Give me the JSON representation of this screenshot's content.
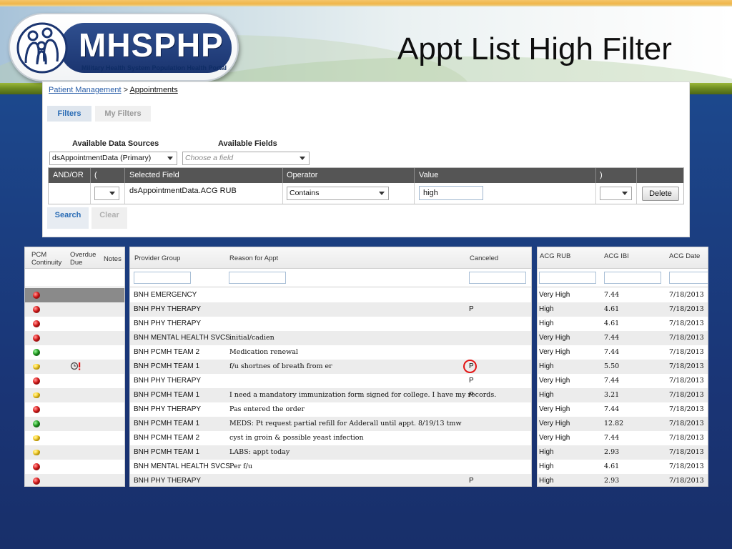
{
  "slide": {
    "title": "Appt List High Filter",
    "logo_text": "MHSPHP",
    "logo_tagline": "Military Health System Population Health Portal"
  },
  "breadcrumb": {
    "root": "Patient Management",
    "separator": ">",
    "current": "Appointments"
  },
  "filter_tabs": [
    "Filters",
    "My Filters"
  ],
  "filter_builder": {
    "available_data_sources_label": "Available Data Sources",
    "available_fields_label": "Available Fields",
    "data_source_value": "dsAppointmentData (Primary)",
    "field_placeholder": "Choose a field",
    "columns": [
      "AND/OR",
      "(",
      "Selected Field",
      "Operator",
      "Value",
      ")"
    ],
    "row": {
      "selected_field": "dsAppointmentData.ACG RUB",
      "operator": "Contains",
      "value": "high",
      "delete_label": "Delete"
    },
    "search_label": "Search",
    "clear_label": "Clear"
  },
  "left_grid": {
    "headers": {
      "pcm_line1": "PCM",
      "pcm_line2": "Continuity",
      "overdue_line1": "Overdue",
      "overdue_line2": "Due",
      "notes": "Notes"
    },
    "rows": [
      {
        "status": "red",
        "overdue": false
      },
      {
        "status": "red",
        "overdue": false
      },
      {
        "status": "red",
        "overdue": false
      },
      {
        "status": "red",
        "overdue": false
      },
      {
        "status": "green",
        "overdue": false
      },
      {
        "status": "yellow",
        "overdue": true
      },
      {
        "status": "red",
        "overdue": false
      },
      {
        "status": "yellow",
        "overdue": false
      },
      {
        "status": "red",
        "overdue": false
      },
      {
        "status": "green",
        "overdue": false
      },
      {
        "status": "yellow",
        "overdue": false
      },
      {
        "status": "yellow",
        "overdue": false
      },
      {
        "status": "red",
        "overdue": false
      },
      {
        "status": "red",
        "overdue": false
      }
    ]
  },
  "middle_grid": {
    "headers": {
      "provider_group": "Provider Group",
      "reason": "Reason for Appt",
      "canceled": "Canceled"
    },
    "rows": [
      {
        "provider_group": "BNH EMERGENCY",
        "reason": "",
        "canceled": ""
      },
      {
        "provider_group": "BNH PHY THERAPY",
        "reason": "",
        "canceled": "P"
      },
      {
        "provider_group": "BNH PHY THERAPY",
        "reason": "",
        "canceled": ""
      },
      {
        "provider_group": "BNH MENTAL HEALTH SVCS",
        "reason": "initial/cadien",
        "canceled": ""
      },
      {
        "provider_group": "BNH PCMH TEAM 2",
        "reason": "Medication renewal",
        "canceled": ""
      },
      {
        "provider_group": "BNH PCMH TEAM 1",
        "reason": "f/u shortnes of breath from er",
        "canceled": "P"
      },
      {
        "provider_group": "BNH PHY THERAPY",
        "reason": "",
        "canceled": "P"
      },
      {
        "provider_group": "BNH PCMH TEAM 1",
        "reason": "I need a mandatory immunization form signed for college. I have my records.",
        "canceled": "P"
      },
      {
        "provider_group": "BNH PHY THERAPY",
        "reason": "Pas entered the order",
        "canceled": ""
      },
      {
        "provider_group": "BNH PCMH TEAM 1",
        "reason": "MEDS: Pt request partial refill for Adderall until appt. 8/19/13 tmw",
        "canceled": ""
      },
      {
        "provider_group": "BNH PCMH TEAM 2",
        "reason": "cyst in groin & possible yeast infection",
        "canceled": ""
      },
      {
        "provider_group": "BNH PCMH TEAM 1",
        "reason": "LABS: appt today",
        "canceled": ""
      },
      {
        "provider_group": "BNH MENTAL HEALTH SVCS",
        "reason": "Per f/u",
        "canceled": ""
      },
      {
        "provider_group": "BNH PHY THERAPY",
        "reason": "",
        "canceled": "P"
      }
    ]
  },
  "right_grid": {
    "headers": {
      "acg_rub": "ACG RUB",
      "acg_ibi": "ACG IBI",
      "acg_date": "ACG Date"
    },
    "rows": [
      {
        "acg_rub": "Very High",
        "acg_ibi": "7.44",
        "acg_date": "7/18/2013"
      },
      {
        "acg_rub": "High",
        "acg_ibi": "4.61",
        "acg_date": "7/18/2013"
      },
      {
        "acg_rub": "High",
        "acg_ibi": "4.61",
        "acg_date": "7/18/2013"
      },
      {
        "acg_rub": "Very High",
        "acg_ibi": "7.44",
        "acg_date": "7/18/2013"
      },
      {
        "acg_rub": "Very High",
        "acg_ibi": "7.44",
        "acg_date": "7/18/2013"
      },
      {
        "acg_rub": "High",
        "acg_ibi": "5.50",
        "acg_date": "7/18/2013"
      },
      {
        "acg_rub": "Very High",
        "acg_ibi": "7.44",
        "acg_date": "7/18/2013"
      },
      {
        "acg_rub": "High",
        "acg_ibi": "3.21",
        "acg_date": "7/18/2013"
      },
      {
        "acg_rub": "Very High",
        "acg_ibi": "7.44",
        "acg_date": "7/18/2013"
      },
      {
        "acg_rub": "Very High",
        "acg_ibi": "12.82",
        "acg_date": "7/18/2013"
      },
      {
        "acg_rub": "Very High",
        "acg_ibi": "7.44",
        "acg_date": "7/18/2013"
      },
      {
        "acg_rub": "High",
        "acg_ibi": "2.93",
        "acg_date": "7/18/2013"
      },
      {
        "acg_rub": "High",
        "acg_ibi": "4.61",
        "acg_date": "7/18/2013"
      },
      {
        "acg_rub": "High",
        "acg_ibi": "2.93",
        "acg_date": "7/18/2013"
      }
    ]
  },
  "colors": {
    "accent_blue": "#2a6cb5",
    "header_dark": "#555555",
    "status_red": "#e21b1b",
    "status_green": "#22a322",
    "status_yellow": "#ffd21a",
    "highlight_ring": "#e31414"
  },
  "icons": {
    "logo_family": "family-figures-icon",
    "overdue": "clock-alert-icon"
  }
}
